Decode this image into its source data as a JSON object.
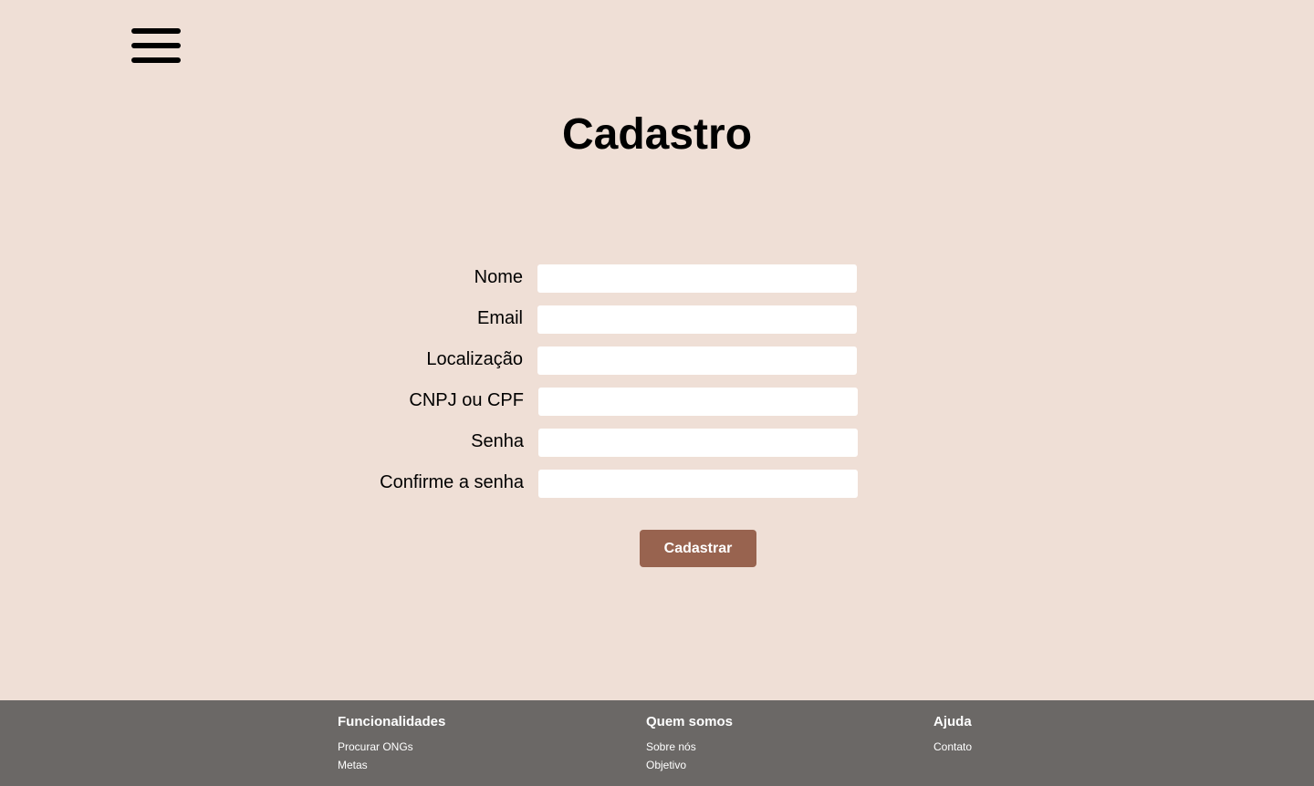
{
  "header": {
    "menu_icon": "hamburger-icon"
  },
  "title": "Cadastro",
  "form": {
    "fields": [
      {
        "label": "Nome",
        "value": ""
      },
      {
        "label": "Email",
        "value": ""
      },
      {
        "label": "Localização",
        "value": ""
      },
      {
        "label": "CNPJ ou CPF",
        "value": ""
      },
      {
        "label": "Senha",
        "value": ""
      },
      {
        "label": "Confirme a senha",
        "value": ""
      }
    ],
    "submit_label": "Cadastrar"
  },
  "colors": {
    "background": "#efdfd6",
    "button": "#98634f",
    "footer": "#6b6866"
  },
  "footer": {
    "columns": [
      {
        "title": "Funcionalidades",
        "links": [
          "Procurar ONGs",
          "Metas"
        ]
      },
      {
        "title": "Quem somos",
        "links": [
          "Sobre nós",
          "Objetivo"
        ]
      },
      {
        "title": "Ajuda",
        "links": [
          "Contato"
        ]
      }
    ]
  }
}
